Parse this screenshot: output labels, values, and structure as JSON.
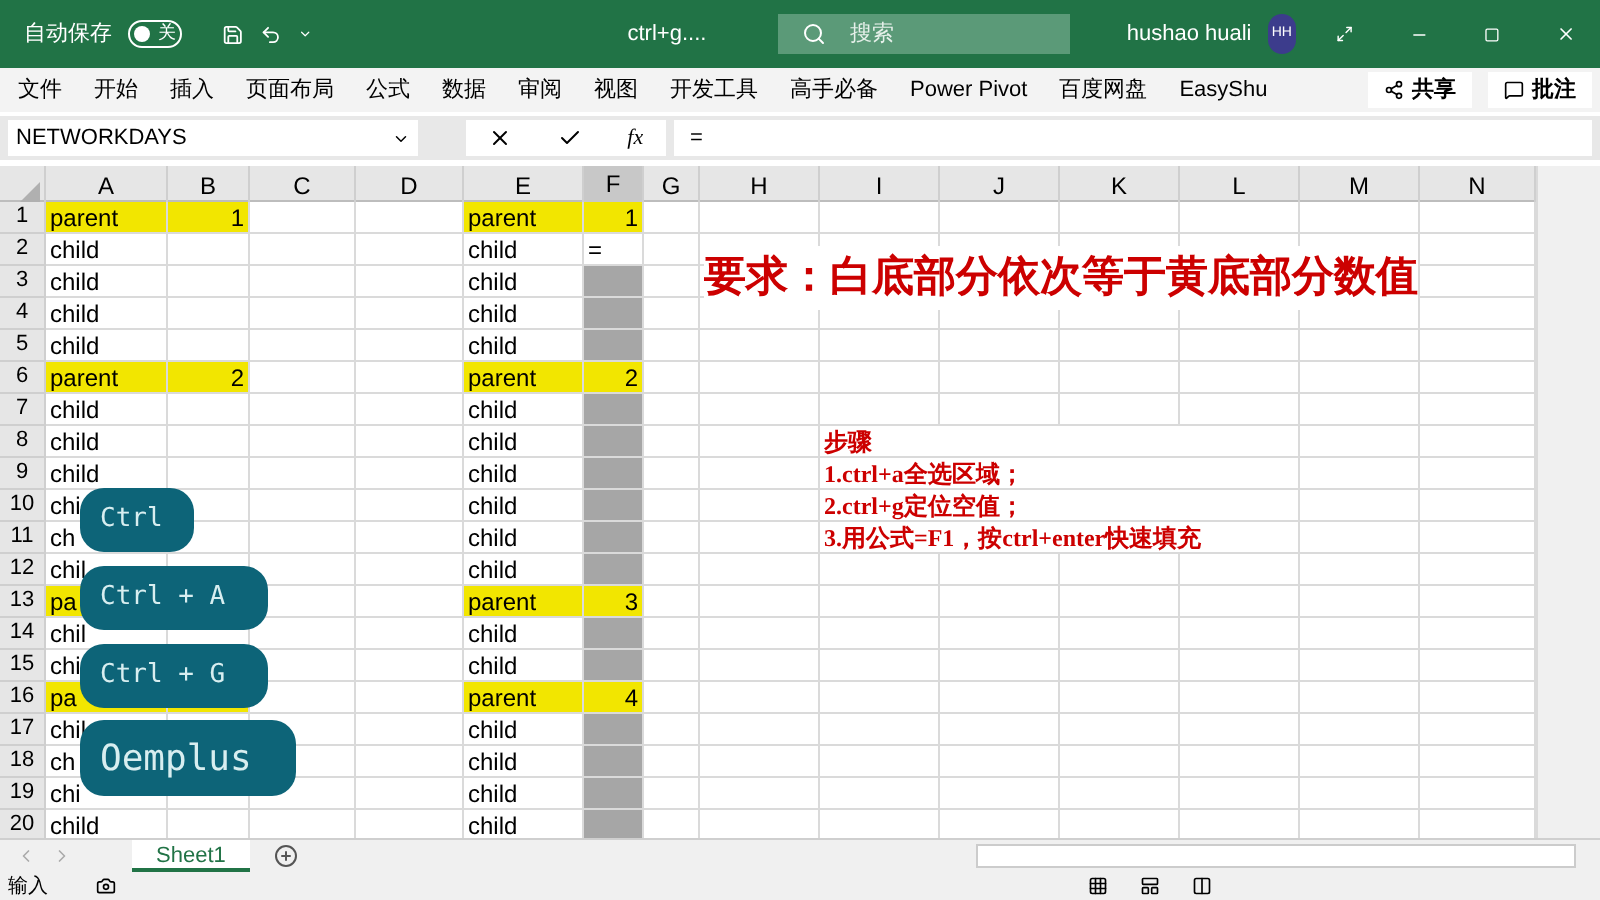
{
  "title_bar": {
    "autosave_label": "自动保存",
    "autosave_toggle": {
      "on": false,
      "label": "关"
    },
    "document_title": "ctrl+g....",
    "search": {
      "placeholder": "搜索"
    },
    "user": "hushao huali",
    "avatar": "HH"
  },
  "ribbon": {
    "tabs": [
      "文件",
      "开始",
      "插入",
      "页面布局",
      "公式",
      "数据",
      "审阅",
      "视图",
      "开发工具",
      "高手必备",
      "Power Pivot",
      "百度网盘",
      "EasyShu"
    ],
    "share": "共享",
    "comments": "批注"
  },
  "formula_bar": {
    "name_box": "NETWORKDAYS",
    "function_label": "fx",
    "formula": "="
  },
  "columns": [
    {
      "label": "A",
      "selected": false
    },
    {
      "label": "B",
      "selected": false
    },
    {
      "label": "C",
      "selected": false
    },
    {
      "label": "D",
      "selected": false
    },
    {
      "label": "E",
      "selected": false
    },
    {
      "label": "F",
      "selected": true
    },
    {
      "label": "G",
      "selected": false
    },
    {
      "label": "H",
      "selected": false
    },
    {
      "label": "I",
      "selected": false
    },
    {
      "label": "J",
      "selected": false
    },
    {
      "label": "K",
      "selected": false
    },
    {
      "label": "L",
      "selected": false
    },
    {
      "label": "M",
      "selected": false
    },
    {
      "label": "N",
      "selected": false
    }
  ],
  "rows": [
    {
      "number": "1",
      "kind": "parent",
      "a": "parent",
      "b": "1",
      "e": "parent",
      "f": "1",
      "f_selected": false
    },
    {
      "number": "2",
      "kind": "child",
      "a": "child",
      "e": "child",
      "f": "=",
      "f_selected": false
    },
    {
      "number": "3",
      "kind": "child",
      "a": "child",
      "e": "child",
      "f_selected": true
    },
    {
      "number": "4",
      "kind": "child",
      "a": "child",
      "e": "child",
      "f_selected": true
    },
    {
      "number": "5",
      "kind": "child",
      "a": "child",
      "e": "child",
      "f_selected": true
    },
    {
      "number": "6",
      "kind": "parent",
      "a": "parent",
      "b": "2",
      "e": "parent",
      "f": "2",
      "f_selected": false
    },
    {
      "number": "7",
      "kind": "child",
      "a": "child",
      "e": "child",
      "f_selected": true
    },
    {
      "number": "8",
      "kind": "child",
      "a": "child",
      "e": "child",
      "f_selected": true
    },
    {
      "number": "9",
      "kind": "child",
      "a": "child",
      "e": "child",
      "f_selected": true
    },
    {
      "number": "10",
      "kind": "child",
      "a": "chi",
      "e": "child",
      "f_selected": true
    },
    {
      "number": "11",
      "kind": "child",
      "a": "ch",
      "e": "child",
      "f_selected": true
    },
    {
      "number": "12",
      "kind": "child",
      "a": "chil",
      "e": "child",
      "f_selected": true
    },
    {
      "number": "13",
      "kind": "parent",
      "a": "pa",
      "e": "parent",
      "f": "3",
      "f_selected": false
    },
    {
      "number": "14",
      "kind": "child",
      "a": "chil",
      "e": "child",
      "f_selected": true
    },
    {
      "number": "15",
      "kind": "child",
      "a": "chi",
      "e": "child",
      "f_selected": true
    },
    {
      "number": "16",
      "kind": "parent",
      "a": "pa",
      "e": "parent",
      "f": "4",
      "f_selected": false
    },
    {
      "number": "17",
      "kind": "child",
      "a": "chil",
      "e": "child",
      "f_selected": true
    },
    {
      "number": "18",
      "kind": "child",
      "a": "ch",
      "e": "child",
      "f_selected": true
    },
    {
      "number": "19",
      "kind": "child",
      "a": "chi",
      "e": "child",
      "f_selected": true
    },
    {
      "number": "20",
      "kind": "child",
      "a": "child",
      "e": "child",
      "f_selected": true
    }
  ],
  "note": {
    "heading": "要求：白底部分依次等于黄底部分数值",
    "steps": [
      "步骤",
      "1.ctrl+a全选区域；",
      "2.ctrl+g定位空值；",
      "3.用公式=F1，按ctrl+enter快速填充"
    ]
  },
  "key_overlays": [
    "Ctrl",
    "Ctrl + A",
    "Ctrl + G",
    "Oemplus"
  ],
  "sheet_tabs": [
    {
      "label": "Sheet1",
      "selected": true
    }
  ],
  "status_bar": {
    "mode": "输入"
  }
}
